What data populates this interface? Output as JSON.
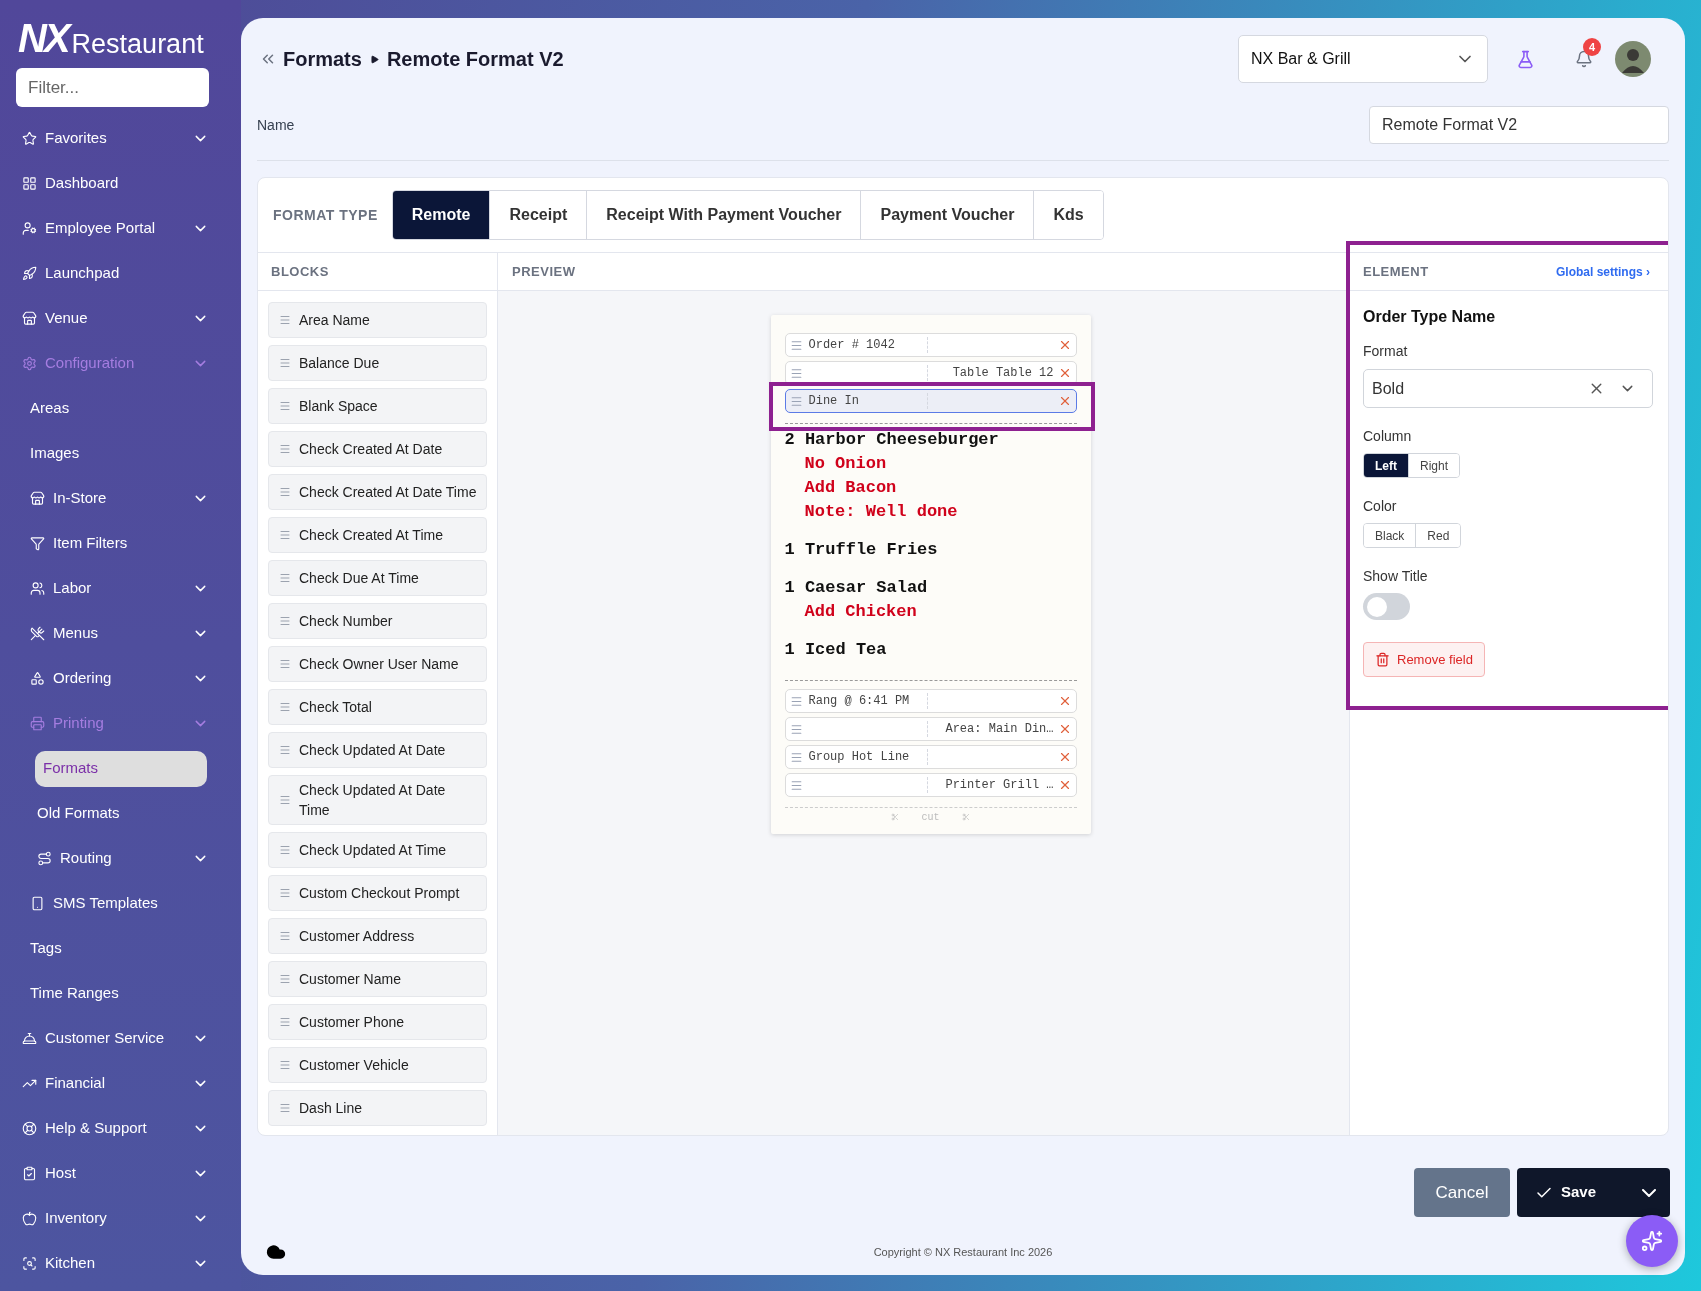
{
  "logo": {
    "mark": "NX",
    "text": "Restaurant"
  },
  "sidebar": {
    "filter_placeholder": "Filter...",
    "items": [
      {
        "label": "Favorites",
        "expanded": false,
        "selected": false
      },
      {
        "label": "Dashboard",
        "selected": false
      },
      {
        "label": "Employee Portal",
        "expanded": false,
        "selected": false
      },
      {
        "label": "Launchpad",
        "selected": false
      },
      {
        "label": "Venue",
        "expanded": false,
        "selected": false
      },
      {
        "label": "Configuration",
        "expanded": true,
        "selected": false,
        "children": [
          {
            "label": "Areas",
            "selected": false
          },
          {
            "label": "Images",
            "selected": false
          },
          {
            "label": "In-Store",
            "expanded": false,
            "selected": false
          },
          {
            "label": "Item Filters",
            "selected": false
          },
          {
            "label": "Labor",
            "expanded": false,
            "selected": false
          },
          {
            "label": "Menus",
            "expanded": false,
            "selected": false
          },
          {
            "label": "Ordering",
            "expanded": false,
            "selected": false
          },
          {
            "label": "Printing",
            "expanded": true,
            "selected": false,
            "children": [
              {
                "label": "Formats",
                "selected": true
              },
              {
                "label": "Old Formats",
                "selected": false
              },
              {
                "label": "Routing",
                "expanded": false,
                "selected": false
              }
            ]
          },
          {
            "label": "SMS Templates",
            "selected": false
          },
          {
            "label": "Tags",
            "selected": false
          },
          {
            "label": "Time Ranges",
            "selected": false
          }
        ]
      },
      {
        "label": "Customer Service",
        "expanded": false,
        "selected": false
      },
      {
        "label": "Financial",
        "expanded": false,
        "selected": false
      },
      {
        "label": "Help & Support",
        "expanded": false,
        "selected": false
      },
      {
        "label": "Host",
        "expanded": false,
        "selected": false
      },
      {
        "label": "Inventory",
        "expanded": false,
        "selected": false
      },
      {
        "label": "Kitchen",
        "expanded": false,
        "selected": false
      }
    ]
  },
  "breadcrumb": [
    "Formats",
    "Remote Format V2"
  ],
  "venue_select": {
    "value": "NX Bar & Grill"
  },
  "notifications": {
    "count": "4"
  },
  "name_field": {
    "label": "Name",
    "value": "Remote Format V2"
  },
  "format_type": {
    "label": "FORMAT TYPE",
    "tabs": [
      {
        "label": "Remote",
        "selected": true
      },
      {
        "label": "Receipt",
        "selected": false
      },
      {
        "label": "Receipt With Payment Voucher",
        "selected": false
      },
      {
        "label": "Payment Voucher",
        "selected": false
      },
      {
        "label": "Kds",
        "selected": false
      }
    ]
  },
  "blocks": {
    "title": "BLOCKS",
    "items": [
      "Area Name",
      "Balance Due",
      "Blank Space",
      "Check Created At Date",
      "Check Created At Date Time",
      "Check Created At Time",
      "Check Due At Time",
      "Check Number",
      "Check Owner User Name",
      "Check Total",
      "Check Updated At Date",
      "Check Updated At Date Time",
      "Check Updated At Time",
      "Custom Checkout Prompt",
      "Customer Address",
      "Customer Name",
      "Customer Phone",
      "Customer Vehicle",
      "Dash Line"
    ]
  },
  "preview": {
    "title": "PREVIEW",
    "header_fields": [
      {
        "left": "Order # 1042",
        "selected": false
      },
      {
        "right": "Table Table 12",
        "selected": false
      },
      {
        "left": "Dine In",
        "selected": true
      }
    ],
    "items": [
      {
        "qty": "2",
        "name": "Harbor Cheeseburger",
        "modifiers": [
          "No Onion",
          "Add Bacon",
          "Note: Well done"
        ]
      },
      {
        "qty": "1",
        "name": "Truffle Fries"
      },
      {
        "qty": "1",
        "name": "Caesar Salad",
        "modifiers": [
          "Add Chicken"
        ]
      },
      {
        "qty": "1",
        "name": "Iced Tea"
      }
    ],
    "footer_fields": [
      {
        "left": "Rang @ 6:41 PM",
        "selected": false
      },
      {
        "right": "Area: Main Din…",
        "selected": false
      },
      {
        "left": "Group Hot Line",
        "selected": false
      },
      {
        "right": "Printer Grill …",
        "selected": false
      }
    ],
    "cut_label": "cut"
  },
  "element": {
    "title": "ELEMENT",
    "global_link": "Global settings ›",
    "name": "Order Type Name",
    "format": {
      "label": "Format",
      "value": "Bold"
    },
    "column": {
      "label": "Column",
      "options": [
        {
          "label": "Left",
          "selected": true
        },
        {
          "label": "Right",
          "selected": false
        }
      ]
    },
    "color": {
      "label": "Color",
      "options": [
        {
          "label": "Black",
          "selected": false
        },
        {
          "label": "Red",
          "selected": false
        }
      ]
    },
    "show_title": {
      "label": "Show Title",
      "on": false
    },
    "remove_button": "Remove field"
  },
  "buttons": {
    "cancel": "Cancel",
    "save": "Save"
  },
  "copyright": "Copyright © NX Restaurant Inc 2026"
}
